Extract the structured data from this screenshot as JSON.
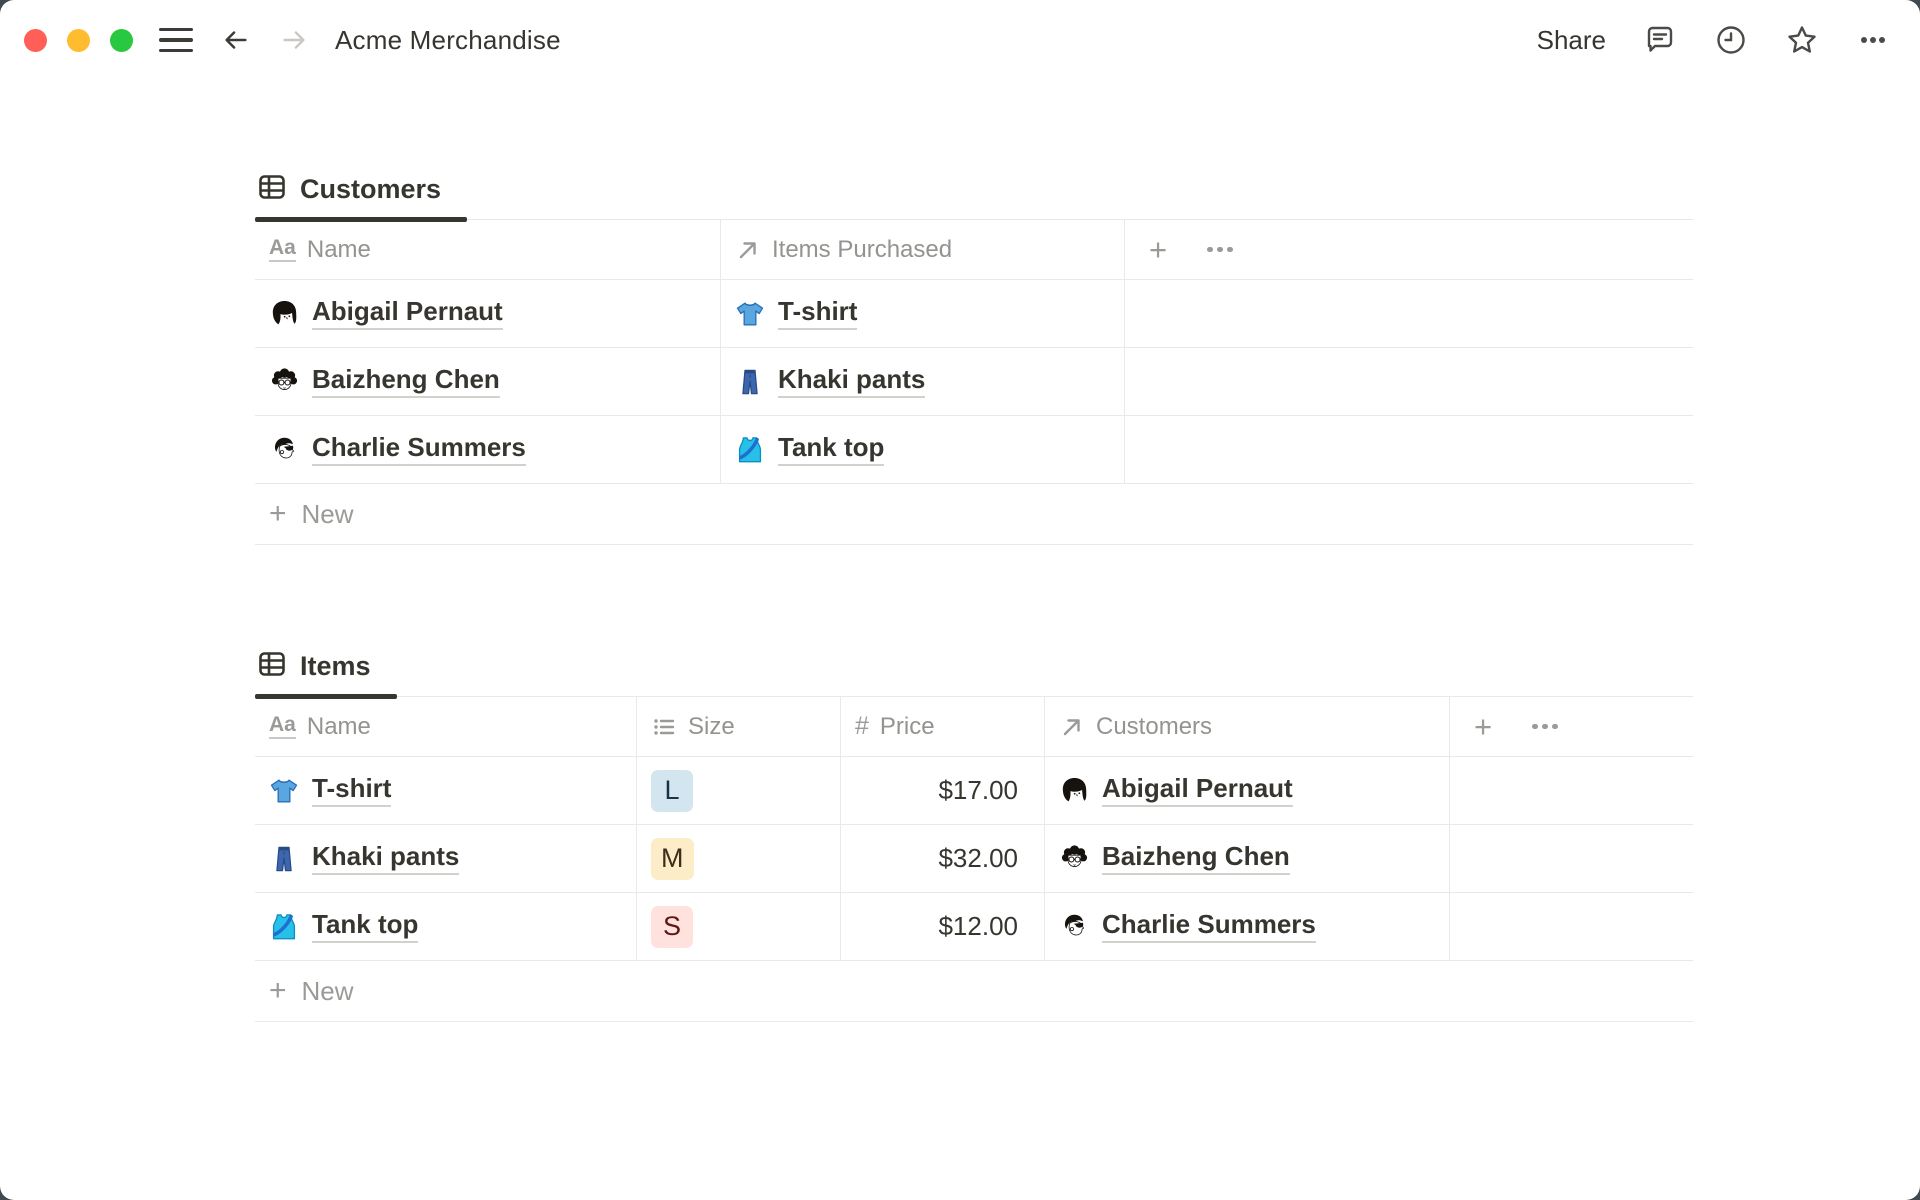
{
  "window_title": "Acme Merchandise",
  "topbar": {
    "share_label": "Share",
    "icons": [
      "comments-icon",
      "updates-clock-icon",
      "favorite-star-icon",
      "more-options-icon"
    ]
  },
  "colors": {
    "traffic_red": "#ff5f57",
    "traffic_yellow": "#febc2e",
    "traffic_green": "#28c840",
    "backdrop": "#3e4a52",
    "active_tab_underline": "#37352f"
  },
  "customers_table": {
    "tab_label": "Customers",
    "tab_icon": "table-view-icon",
    "columns": [
      {
        "icon": "text-property-icon",
        "label": "Name"
      },
      {
        "icon": "relation-property-icon",
        "label": "Items Purchased"
      }
    ],
    "rows": [
      {
        "cells": [
          {
            "type": "page",
            "icon": "abigail-avatar",
            "label": "Abigail Pernaut"
          },
          {
            "type": "page",
            "icon": "tshirt-icon",
            "label": "T-shirt"
          }
        ]
      },
      {
        "cells": [
          {
            "type": "page",
            "icon": "baizheng-avatar",
            "label": "Baizheng Chen"
          },
          {
            "type": "page",
            "icon": "khaki-pants-icon",
            "label": "Khaki pants"
          }
        ]
      },
      {
        "cells": [
          {
            "type": "page",
            "icon": "charlie-avatar",
            "label": "Charlie Summers"
          },
          {
            "type": "page",
            "icon": "tank-top-icon",
            "label": "Tank top"
          }
        ]
      }
    ],
    "new_label": "New"
  },
  "items_table": {
    "tab_label": "Items",
    "tab_icon": "table-view-icon",
    "columns": [
      {
        "icon": "text-property-icon",
        "label": "Name"
      },
      {
        "icon": "select-property-icon",
        "label": "Size"
      },
      {
        "icon": "number-property-icon",
        "label": "Price"
      },
      {
        "icon": "relation-property-icon",
        "label": "Customers"
      }
    ],
    "rows": [
      {
        "cells": [
          {
            "type": "page",
            "icon": "tshirt-icon",
            "label": "T-shirt"
          },
          {
            "type": "tag",
            "label": "L",
            "bg": "#d3e5ef",
            "fg": "#183347"
          },
          {
            "type": "number",
            "label": "$17.00"
          },
          {
            "type": "page",
            "icon": "abigail-avatar",
            "label": "Abigail Pernaut"
          }
        ]
      },
      {
        "cells": [
          {
            "type": "page",
            "icon": "khaki-pants-icon",
            "label": "Khaki pants"
          },
          {
            "type": "tag",
            "label": "M",
            "bg": "#fdecc8",
            "fg": "#402c1b"
          },
          {
            "type": "number",
            "label": "$32.00"
          },
          {
            "type": "page",
            "icon": "baizheng-avatar",
            "label": "Baizheng Chen"
          }
        ]
      },
      {
        "cells": [
          {
            "type": "page",
            "icon": "tank-top-icon",
            "label": "Tank top"
          },
          {
            "type": "tag",
            "label": "S",
            "bg": "#ffe2dd",
            "fg": "#5d1715"
          },
          {
            "type": "number",
            "label": "$12.00"
          },
          {
            "type": "page",
            "icon": "charlie-avatar",
            "label": "Charlie Summers"
          }
        ]
      }
    ],
    "new_label": "New"
  }
}
